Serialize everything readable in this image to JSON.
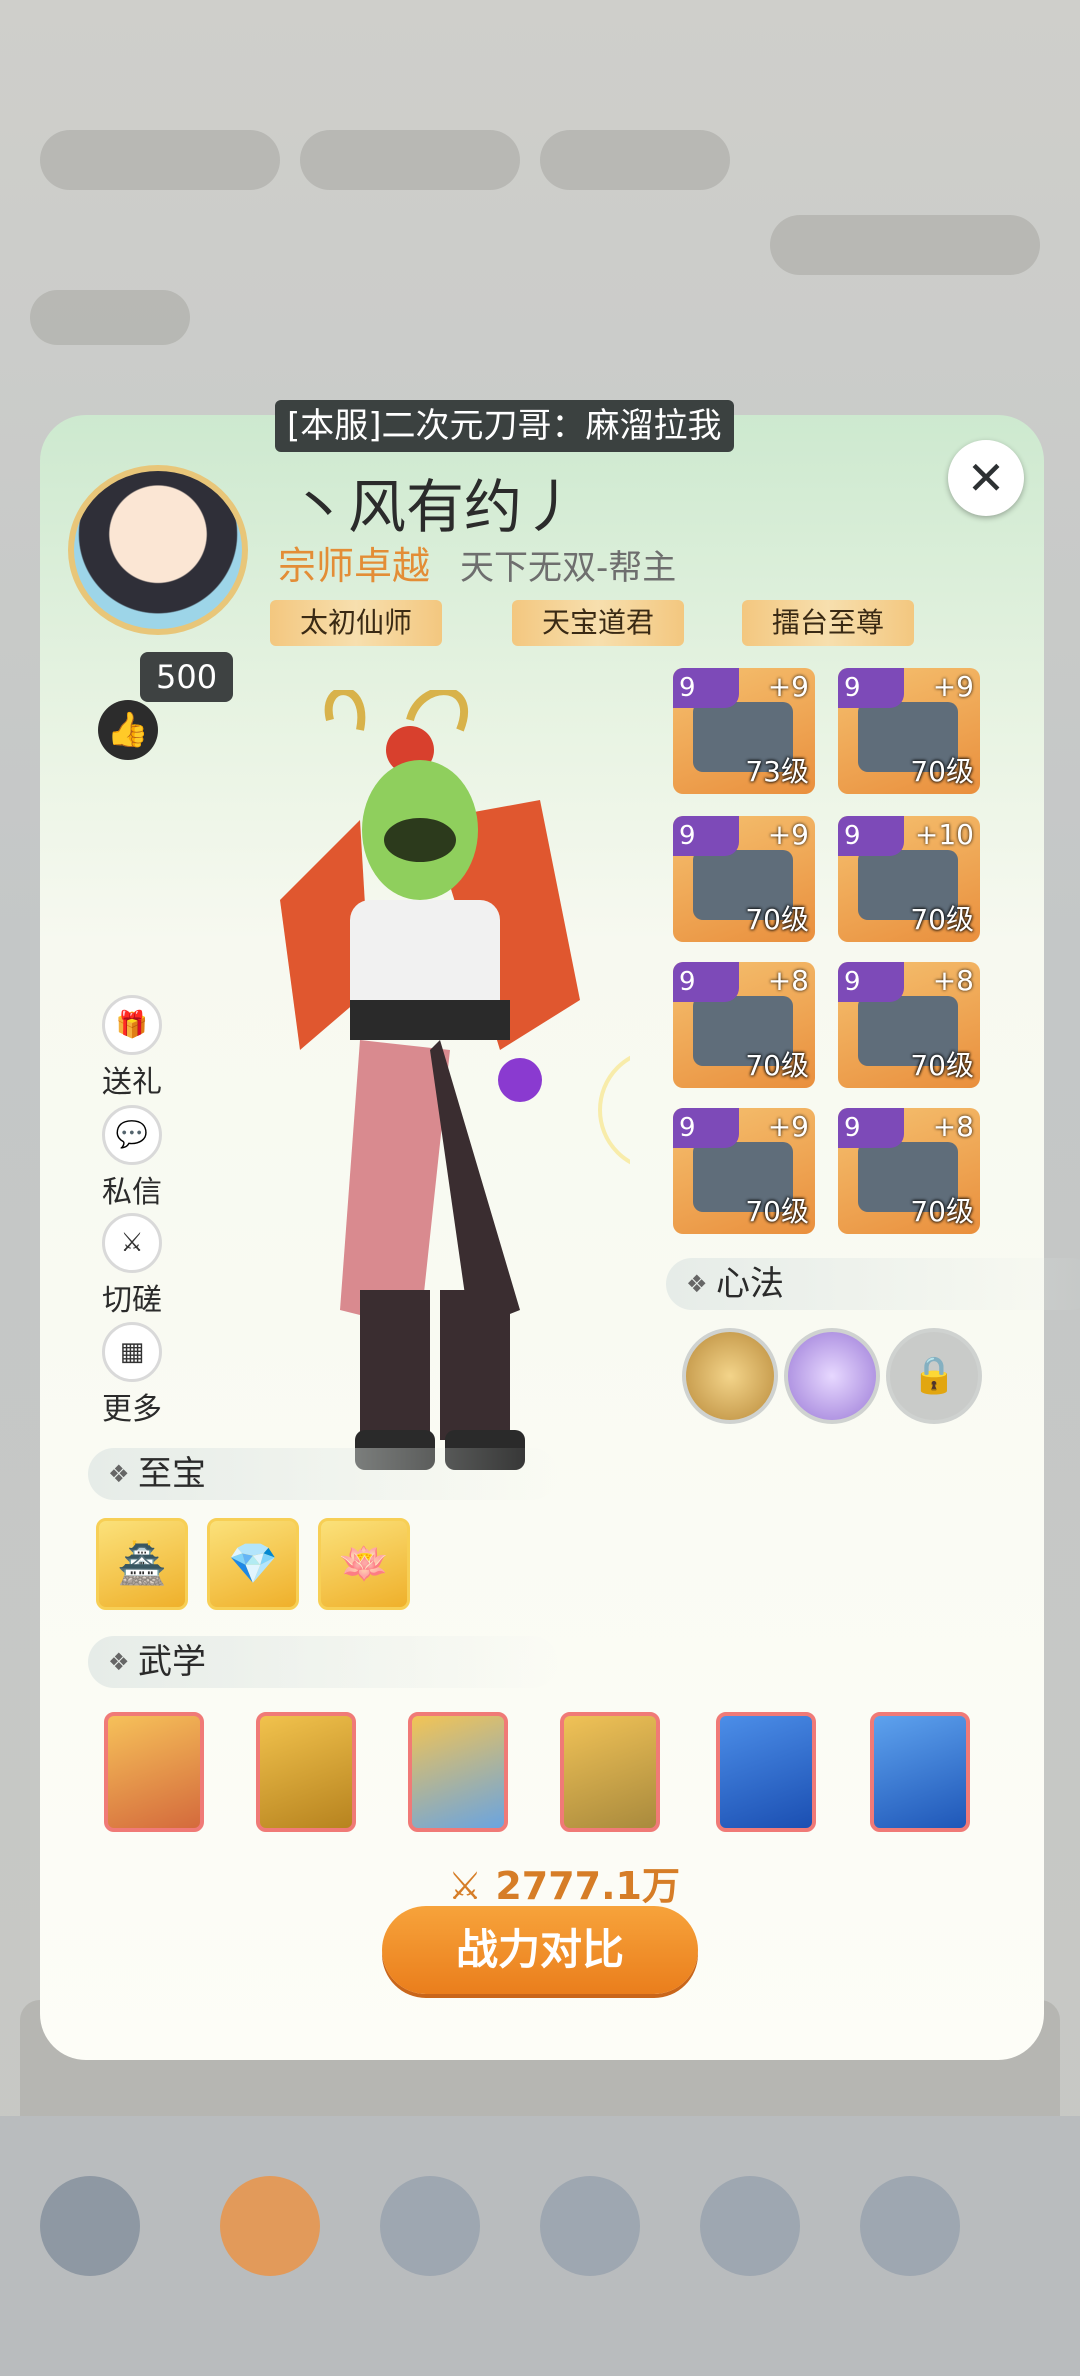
{
  "header": {
    "server_tag": "[本服]二次元刀哥：麻溜拉我",
    "close_label": "✕"
  },
  "profile": {
    "name": "丶风有约丿",
    "rank": "宗师卓越",
    "guild": "天下无双-帮主",
    "titles": [
      "太初仙师",
      "天宝道君",
      "擂台至尊"
    ],
    "likes": "500"
  },
  "side_actions": [
    {
      "label": "送礼",
      "icon": "gift-icon"
    },
    {
      "label": "私信",
      "icon": "chat-icon"
    },
    {
      "label": "切磋",
      "icon": "swords-icon"
    },
    {
      "label": "更多",
      "icon": "more-grid-icon"
    }
  ],
  "equipment": [
    {
      "slot": "weapon",
      "quality": "9",
      "enhance": "+9",
      "level": "73级"
    },
    {
      "slot": "helmet",
      "quality": "9",
      "enhance": "+9",
      "level": "70级"
    },
    {
      "slot": "armor",
      "quality": "9",
      "enhance": "+9",
      "level": "70级"
    },
    {
      "slot": "robe",
      "quality": "9",
      "enhance": "+10",
      "level": "70级"
    },
    {
      "slot": "bracer",
      "quality": "9",
      "enhance": "+8",
      "level": "70级"
    },
    {
      "slot": "boots",
      "quality": "9",
      "enhance": "+8",
      "level": "70级"
    },
    {
      "slot": "ring",
      "quality": "9",
      "enhance": "+9",
      "level": "70级"
    },
    {
      "slot": "pendant",
      "quality": "9",
      "enhance": "+8",
      "level": "70级"
    }
  ],
  "sections": {
    "mind_method": "心法",
    "treasure": "至宝",
    "martial": "武学"
  },
  "battle": {
    "power": "2777.1万",
    "compare_label": "战力对比"
  },
  "colors": {
    "accent_orange": "#ea7e1c",
    "quality_purple": "#7d4ab8",
    "rank_orange": "#e38d36"
  }
}
